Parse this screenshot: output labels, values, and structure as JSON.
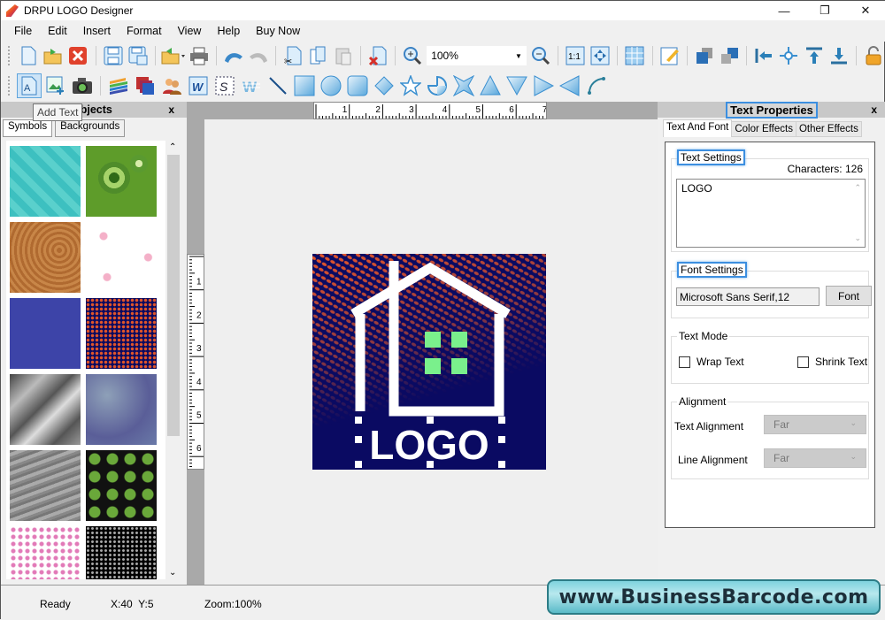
{
  "window": {
    "title": "DRPU LOGO Designer",
    "minimize": "—",
    "maximize": "❐",
    "close": "✕"
  },
  "menu": [
    "File",
    "Edit",
    "Insert",
    "Format",
    "View",
    "Help",
    "Buy Now"
  ],
  "toolbar1": {
    "buttons": [
      "new-file",
      "open-file",
      "close-file",
      "save",
      "save-as",
      "export",
      "print",
      "undo",
      "redo",
      "cut",
      "copy",
      "paste",
      "delete",
      "zoom-in"
    ],
    "zoom_value": "100%",
    "buttons_after": [
      "zoom-out",
      "actual-size",
      "fit-to-window",
      "grid",
      "edit-properties",
      "bring-forward",
      "send-backward",
      "align-left",
      "align-center",
      "align-top",
      "align-bottom",
      "lock"
    ]
  },
  "toolbar2": {
    "buttons": [
      "add-text",
      "add-image",
      "camera",
      "layers",
      "backgrounds",
      "symbols",
      "word-art",
      "signature",
      "watermark",
      "line",
      "rectangle",
      "ellipse",
      "rounded-rectangle",
      "diamond",
      "star",
      "pie",
      "four-point-star",
      "triangle",
      "inverted-triangle",
      "right-triangle",
      "left-triangle",
      "arc"
    ],
    "tooltip": "Add Text"
  },
  "left_panel": {
    "title": "Objects",
    "close": "x",
    "tabs": [
      "Symbols",
      "Backgrounds"
    ],
    "selected_tab": "Symbols",
    "thumbnails": [
      "teal-geometric",
      "green-circles",
      "wood-grain",
      "pink-roses",
      "blue-texture",
      "orange-dots-navy",
      "gray-silk",
      "misty-blue",
      "gray-marble",
      "green-leaves",
      "pink-floral",
      "black-dot-grid"
    ]
  },
  "canvas": {
    "hruler_labels": [
      "1",
      "2",
      "3",
      "4",
      "5",
      "6",
      "7"
    ],
    "vruler_labels": [
      "1",
      "2",
      "3",
      "4",
      "5",
      "6"
    ],
    "logo_text": "LOGO"
  },
  "right_panel": {
    "title": "Text Properties",
    "close": "x",
    "tabs": [
      "Text And Font",
      "Color Effects",
      "Other Effects"
    ],
    "selected_tab": "Text And Font",
    "text_settings": {
      "label": "Text Settings",
      "characters": "Characters: 126",
      "text": "LOGO"
    },
    "font_settings": {
      "label": "Font Settings",
      "font_value": "Microsoft Sans Serif,12",
      "font_button": "Font"
    },
    "text_mode": {
      "label": "Text Mode",
      "wrap_text": "Wrap Text",
      "wrap_checked": false,
      "shrink_text": "Shrink Text",
      "shrink_checked": false
    },
    "alignment": {
      "label": "Alignment",
      "text_alignment_label": "Text Alignment",
      "text_alignment_value": "Far",
      "line_alignment_label": "Line Alignment",
      "line_alignment_value": "Far"
    }
  },
  "status": {
    "state": "Ready",
    "coords": "X:40  Y:5",
    "zoom": "Zoom:100%"
  },
  "brand_banner": "www.BusinessBarcode.com"
}
